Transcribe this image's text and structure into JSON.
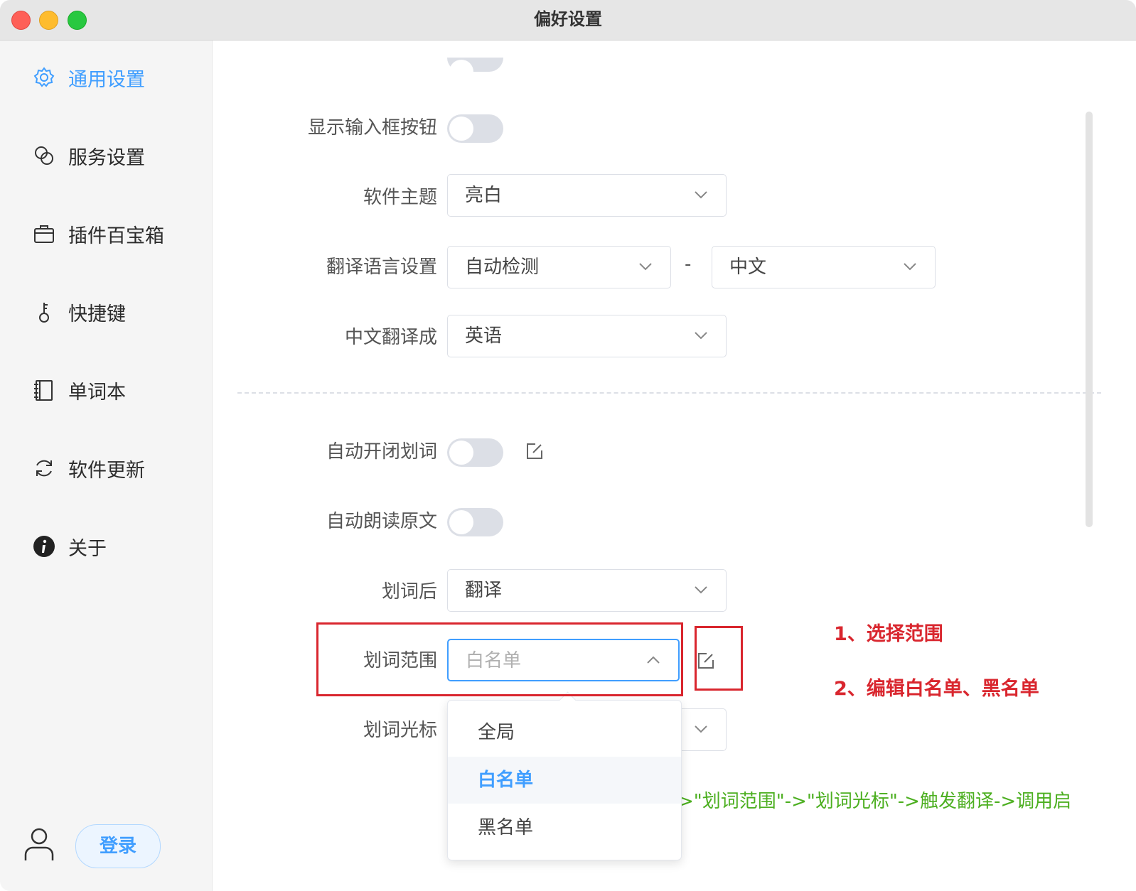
{
  "window": {
    "title": "偏好设置"
  },
  "sidebar": {
    "items": [
      {
        "label": "通用设置",
        "icon": "gear-icon",
        "active": true
      },
      {
        "label": "服务设置",
        "icon": "service-icon"
      },
      {
        "label": "插件百宝箱",
        "icon": "briefcase-icon"
      },
      {
        "label": "快捷键",
        "icon": "key-icon"
      },
      {
        "label": "单词本",
        "icon": "notebook-icon"
      },
      {
        "label": "软件更新",
        "icon": "refresh-icon"
      },
      {
        "label": "关于",
        "icon": "info-icon"
      }
    ],
    "login_label": "登录"
  },
  "settings": {
    "show_input_button": {
      "label": "显示输入框按钮",
      "on": false
    },
    "theme": {
      "label": "软件主题",
      "value": "亮白"
    },
    "translate_lang": {
      "label": "翻译语言设置",
      "source": "自动检测",
      "separator": "-",
      "target": "中文"
    },
    "chinese_to": {
      "label": "中文翻译成",
      "value": "英语"
    },
    "auto_toggle_select": {
      "label": "自动开闭划词",
      "on": false
    },
    "auto_read": {
      "label": "自动朗读原文",
      "on": false
    },
    "after_select": {
      "label": "划词后",
      "value": "翻译"
    },
    "select_scope": {
      "label": "划词范围",
      "value": "白名单"
    },
    "select_cursor": {
      "label": "划词光标"
    }
  },
  "dropdown": {
    "options": [
      "全局",
      "白名单",
      "黑名单"
    ],
    "selected": "白名单"
  },
  "annotations": {
    "step1": "1、选择范围",
    "step2": "2、编辑白名单、黑名单",
    "flow_note": ">\"划词范围\"->\"划词光标\"->触发翻译->调用启"
  },
  "colors": {
    "accent": "#409eff",
    "annotation_red": "#d9262e",
    "note_green": "#4caf20"
  }
}
